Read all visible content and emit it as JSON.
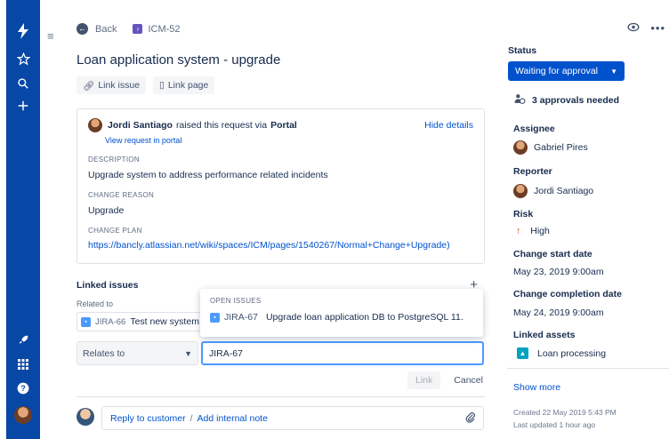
{
  "nav": {
    "icons": [
      "jira-logo-icon",
      "star-icon",
      "search-icon",
      "plus-icon",
      "rocket-icon",
      "apps-grid-icon",
      "help-icon",
      "avatar"
    ]
  },
  "breadcrumb": {
    "back_label": "Back",
    "issue_key": "ICM-52"
  },
  "title": "Loan application system - upgrade",
  "buttons": {
    "link_issue": "Link issue",
    "link_page": "Link page"
  },
  "request": {
    "reporter": "Jordi Santiago",
    "raised_text": "raised this request via",
    "channel": "Portal",
    "hide_details": "Hide details",
    "view_request": "View request in portal",
    "description_label": "DESCRIPTION",
    "description": "Upgrade system to address performance related incidents",
    "change_reason_label": "CHANGE REASON",
    "change_reason": "Upgrade",
    "change_plan_label": "CHANGE PLAN",
    "change_plan_url": "https://bancly.atlassian.net/wiki/spaces/ICM/pages/1540267/Normal+Change+Upgrade)"
  },
  "linked": {
    "heading": "Linked issues",
    "related_label": "Related to",
    "existing": {
      "key": "JIRA-66",
      "summary": "Test new system"
    },
    "popup": {
      "header": "OPEN ISSUES",
      "key": "JIRA-67",
      "summary": "Upgrade loan application DB to PostgreSQL 11."
    },
    "relation_select": "Relates to",
    "input_value": "JIRA-67",
    "link_button": "Link",
    "cancel_button": "Cancel"
  },
  "comment": {
    "reply": "Reply to customer",
    "separator": "/",
    "internal": "Add internal note"
  },
  "sidebar": {
    "status_label": "Status",
    "status_value": "Waiting for approval",
    "approvals": "3 approvals needed",
    "assignee_label": "Assignee",
    "assignee": "Gabriel Pires",
    "reporter_label": "Reporter",
    "reporter": "Jordi Santiago",
    "risk_label": "Risk",
    "risk": "High",
    "change_start_label": "Change start date",
    "change_start": "May 23, 2019 9:00am",
    "change_completion_label": "Change completion date",
    "change_completion": "May 24, 2019 9:00am",
    "linked_assets_label": "Linked assets",
    "asset": "Loan processing",
    "show_more": "Show more",
    "created": "Created 22 May 2019 5:43 PM",
    "updated": "Last updated 1 hour ago"
  },
  "colors": {
    "nav": "#0747A6",
    "primary": "#0052CC",
    "risk_high": "#DE350B"
  }
}
